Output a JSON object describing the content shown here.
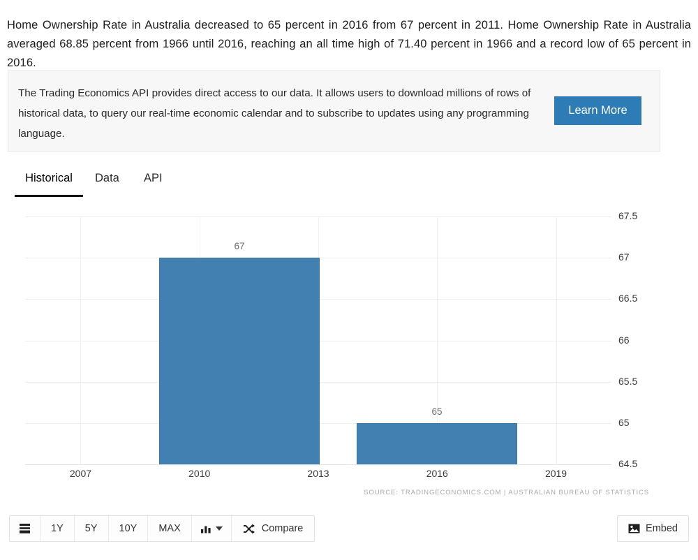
{
  "intro": {
    "text": "Home Ownership Rate in Australia decreased to 65 percent in 2016 from 67 percent in 2011. Home Ownership Rate in Australia averaged 68.85 percent from 1966 until 2016, reaching an all time high of 71.40 percent in 1966 and a record low of 65 percent in 2016."
  },
  "promo": {
    "text": "The Trading Economics API provides direct access to our data. It allows users to download millions of rows of historical data, to query our real-time economic calendar and to subscribe to updates using any programming language.",
    "button_label": "Learn More",
    "button_color": "#2d7cb5",
    "background": "#f7f7f7"
  },
  "tabs": [
    {
      "label": "Historical",
      "active": true
    },
    {
      "label": "Data",
      "active": false
    },
    {
      "label": "API",
      "active": false
    }
  ],
  "chart_data": {
    "type": "bar",
    "title": "",
    "subtitle": "",
    "xlabel": "",
    "ylabel": "",
    "categories": [
      "2011",
      "2016"
    ],
    "values": [
      67,
      65
    ],
    "data_labels": [
      "67",
      "65"
    ],
    "series": [
      {
        "name": "Home Ownership Rate",
        "values": [
          67,
          65
        ]
      }
    ],
    "ylim": [
      64.5,
      67.5
    ],
    "yticks": [
      "67.5",
      "67",
      "66.5",
      "66",
      "65.5",
      "65",
      "64.5"
    ],
    "ytick_values": [
      67.5,
      67,
      66.5,
      66,
      65.5,
      65,
      64.5
    ],
    "xticks": [
      "2007",
      "2010",
      "2013",
      "2016",
      "2019"
    ],
    "xtick_values": [
      2007,
      2010,
      2013,
      2016,
      2019
    ],
    "xlim": [
      2005.6,
      2020.4
    ],
    "grid": true,
    "y_axis_position": "right",
    "legend": "none",
    "bar_color": "#4180b0",
    "unit": "percent"
  },
  "source": {
    "text": "SOURCE: TRADINGECONOMICS.COM  |  AUSTRALIAN BUREAU OF STATISTICS"
  },
  "toolbar": {
    "menu_icon": "list-icon",
    "ranges": [
      "1Y",
      "5Y",
      "10Y",
      "MAX"
    ],
    "charttype_icon": "bar-chart-icon",
    "compare_icon": "shuffle-icon",
    "compare_label": "Compare",
    "embed_icon": "image-icon",
    "embed_label": "Embed"
  }
}
